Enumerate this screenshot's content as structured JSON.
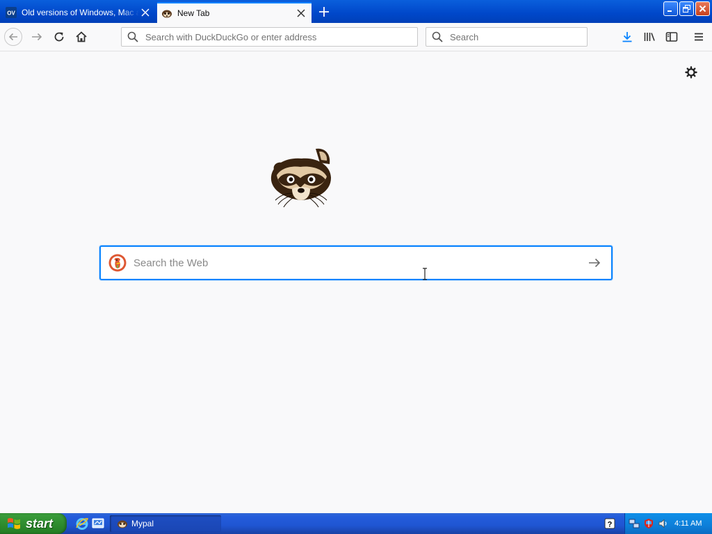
{
  "tabs": [
    {
      "label": "Old versions of Windows, Mac and Linux software",
      "favicon": "ov-favicon",
      "active": false
    },
    {
      "label": "New Tab",
      "favicon": "raccoon-favicon",
      "active": true
    }
  ],
  "window_controls": [
    "minimize",
    "restore",
    "close"
  ],
  "navbar": {
    "url_placeholder": "Search with DuckDuckGo or enter address",
    "search_placeholder": "Search"
  },
  "newtab": {
    "search_placeholder": "Search the Web",
    "search_engine_icon": "duckduckgo-icon"
  },
  "taskbar": {
    "start_label": "start",
    "task_label": "Mypal",
    "clock": "4:11 AM"
  },
  "colors": {
    "accent": "#0a84ff",
    "titlebar": "#0047c9",
    "start_green": "#2f8d2f"
  }
}
